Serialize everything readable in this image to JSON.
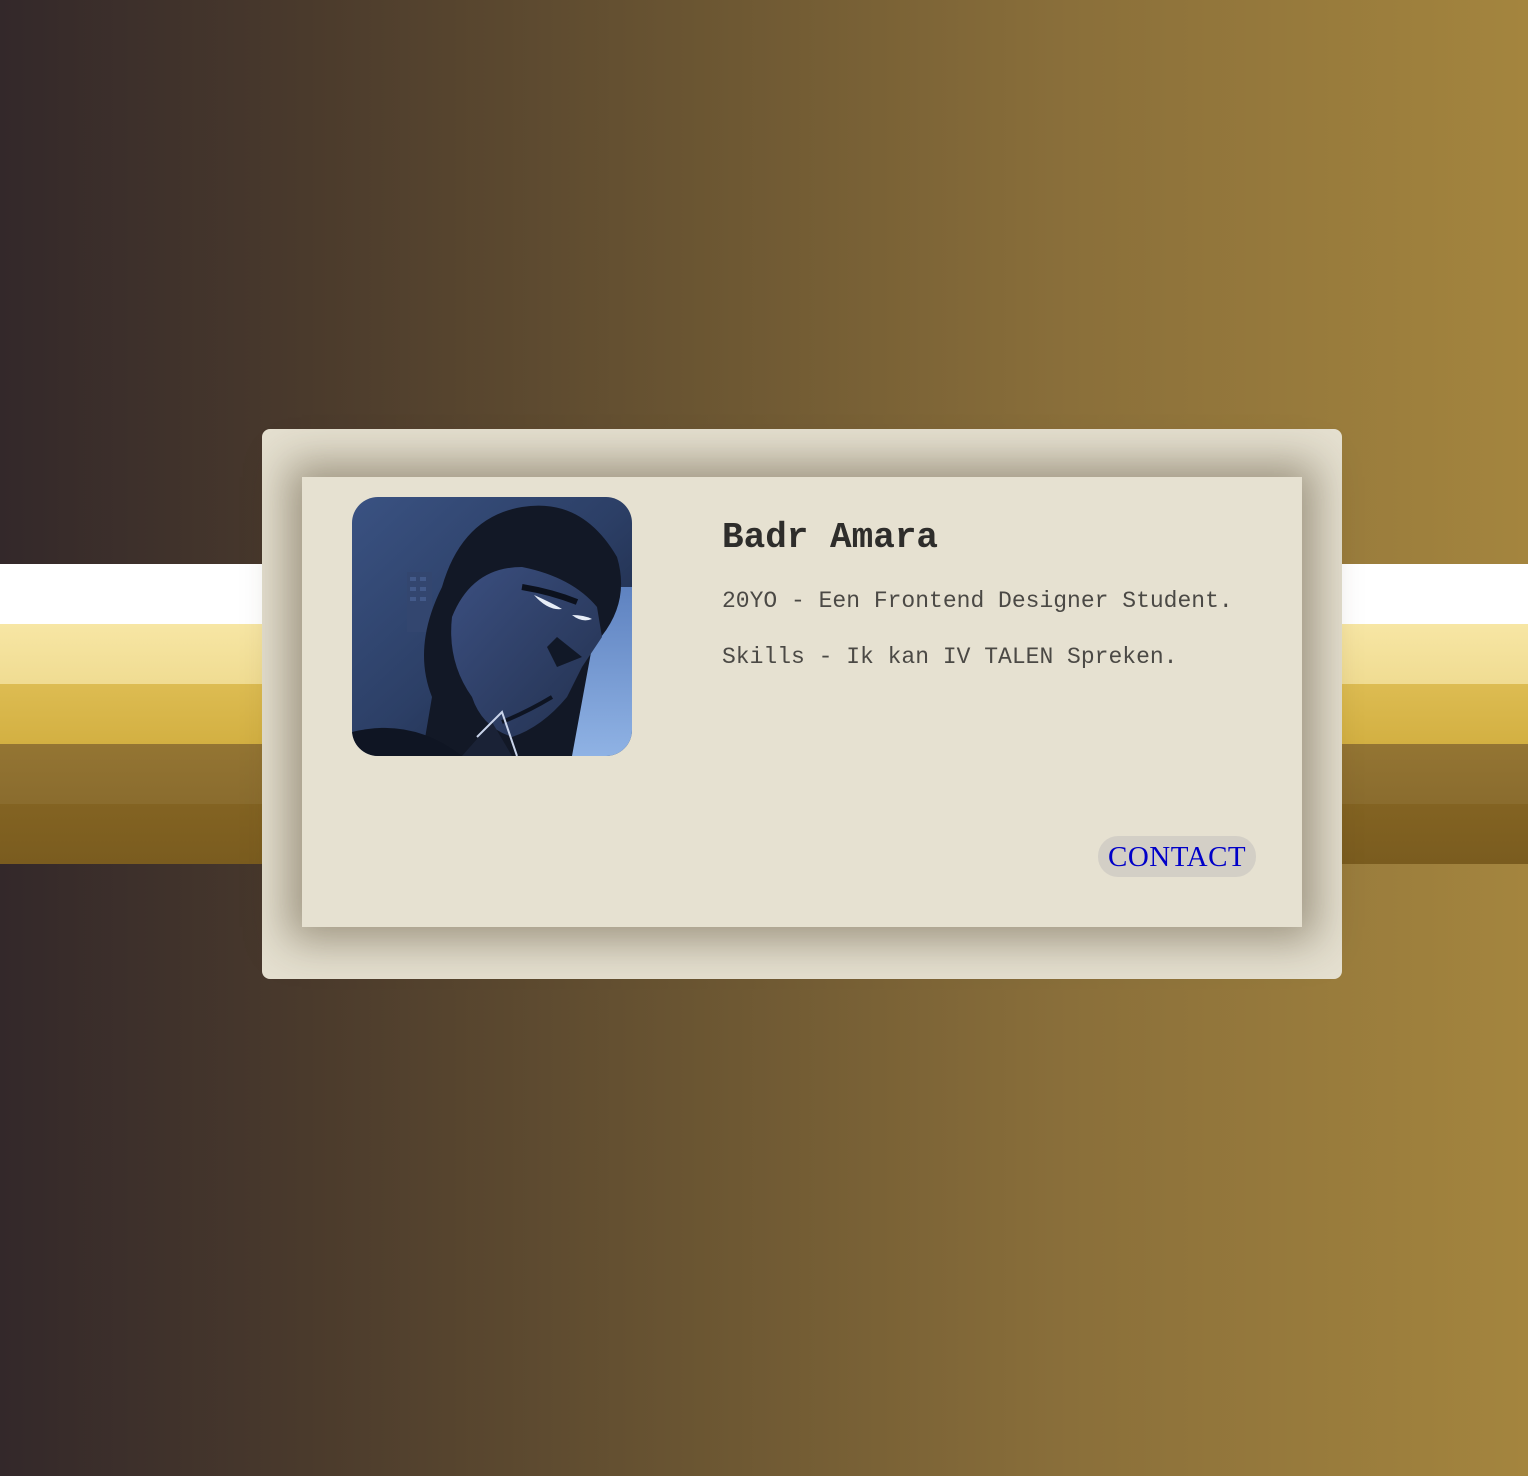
{
  "profile": {
    "name": "Badr Amara",
    "age_line": "20YO - Een Frontend Designer Student.",
    "skills_line": "Skills - Ik kan IV TALEN Spreken.",
    "contact_label": "CONTACT"
  },
  "colors": {
    "background_start": "#33282a",
    "background_end": "#a4853e",
    "card": "#e6e1d1",
    "name_text": "#2e2d2b",
    "body_text": "#4b4945",
    "link": "#0000c8",
    "link_background": "#d3cfc6"
  },
  "stripes": [
    {
      "color": "#ffffff"
    },
    {
      "color": "#f4e29c"
    },
    {
      "color": "#d8b74a"
    },
    {
      "color": "#8f7231"
    },
    {
      "color": "#7e5f20"
    }
  ]
}
